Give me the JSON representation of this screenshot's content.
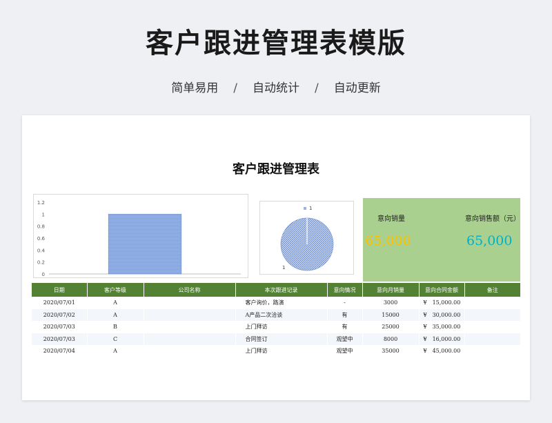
{
  "banner": {
    "title": "客户跟进管理表模版",
    "subtitle": [
      "简单易用",
      "自动统计",
      "自动更新"
    ],
    "separator": "/"
  },
  "sheet": {
    "title": "客户跟进管理表"
  },
  "kpi": {
    "label_qty": "意向销量",
    "value_qty": "65,000",
    "label_amount": "意向销售额（元）",
    "value_amount": "65,000",
    "color_qty": "#ffc000",
    "color_amount": "#00b0c8",
    "bg": "#a9d08e"
  },
  "chart_data": [
    {
      "type": "bar",
      "categories": [
        ""
      ],
      "values": [
        1
      ],
      "ylim": [
        0,
        1.2
      ],
      "yticks": [
        "1.2",
        "1",
        "0.8",
        "0.6",
        "0.4",
        "0.2",
        "0"
      ],
      "color": "#7f9fd6"
    },
    {
      "type": "pie",
      "legend": [
        "1"
      ],
      "values": [
        1
      ],
      "labels": [
        "1"
      ],
      "color": "#9ab3e0"
    }
  ],
  "table": {
    "headers": [
      "日期",
      "客户等级",
      "公司名称",
      "本次跟进记录",
      "意向情况",
      "意向月销量",
      "意向合同金额",
      "备注"
    ],
    "rows": [
      [
        "2020/07/01",
        "A",
        "",
        "客户询价，路演",
        "-",
        "3000",
        "¥　15,000.00",
        ""
      ],
      [
        "2020/07/02",
        "A",
        "",
        "A产品二次洽谈",
        "有",
        "15000",
        "¥　30,000.00",
        ""
      ],
      [
        "2020/07/03",
        "B",
        "",
        "上门拜访",
        "有",
        "25000",
        "¥　35,000.00",
        ""
      ],
      [
        "2020/07/03",
        "C",
        "",
        "合同签订",
        "观望中",
        "8000",
        "¥　16,000.00",
        ""
      ],
      [
        "2020/07/04",
        "A",
        "",
        "上门拜访",
        "观望中",
        "35000",
        "¥　45,000.00",
        ""
      ]
    ]
  }
}
